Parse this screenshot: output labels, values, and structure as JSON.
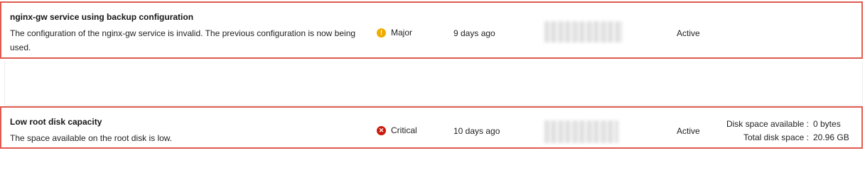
{
  "alerts": [
    {
      "title": "nginx-gw service using backup configuration",
      "description": "The configuration of the nginx-gw service is invalid. The previous configuration is now being used.",
      "severity": "Major",
      "severity_color": "#f0ab00",
      "severity_icon": "exclamation-circle-icon",
      "time": "9 days ago",
      "status": "Active"
    },
    {
      "title": "Low root disk capacity",
      "description": "The space available on the root disk is low.",
      "severity": "Critical",
      "severity_color": "#c9190b",
      "severity_icon": "times-circle-icon",
      "time": "10 days ago",
      "status": "Active",
      "details": [
        {
          "label": "Disk space available :",
          "value": "0 bytes"
        },
        {
          "label": "Total disk space :",
          "value": "20.96 GB"
        }
      ]
    }
  ],
  "highlight_color": "#e05a4e"
}
